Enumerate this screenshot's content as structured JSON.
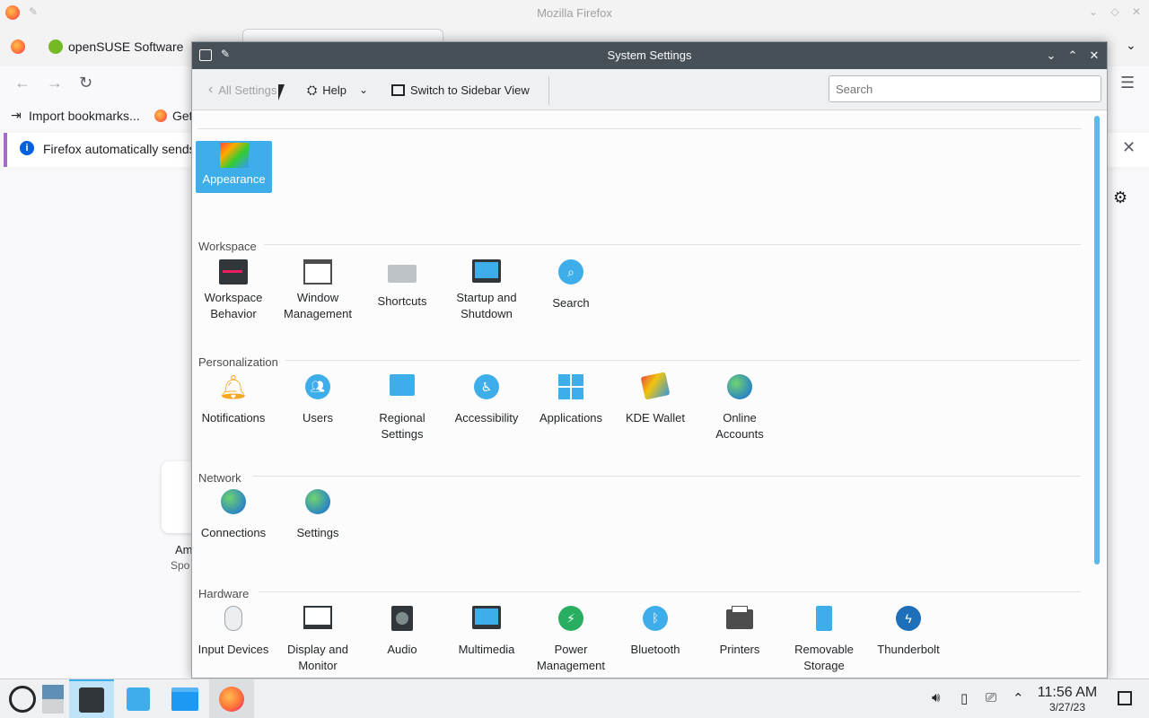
{
  "firefox": {
    "window_title": "Mozilla Firefox",
    "tab_title": "openSUSE Software",
    "bookmark_import": "Import bookmarks...",
    "bookmark_get": "Get",
    "notice_text": "Firefox automatically sends",
    "card_title": "Am",
    "card_sub": "Spo"
  },
  "settings": {
    "window_title": "System Settings",
    "toolbar": {
      "back_label": "All Settings",
      "help_label": "Help",
      "sidebar_view_label": "Switch to Sidebar View",
      "search_placeholder": "Search"
    },
    "top": {
      "appearance": "Appearance"
    },
    "workspace": {
      "title": "Workspace",
      "items": [
        "Workspace Behavior",
        "Window Management",
        "Shortcuts",
        "Startup and Shutdown",
        "Search"
      ]
    },
    "personalization": {
      "title": "Personalization",
      "items": [
        "Notifications",
        "Users",
        "Regional Settings",
        "Accessibility",
        "Applications",
        "KDE Wallet",
        "Online Accounts"
      ]
    },
    "network": {
      "title": "Network",
      "items": [
        "Connections",
        "Settings"
      ]
    },
    "hardware": {
      "title": "Hardware",
      "items": [
        "Input Devices",
        "Display and Monitor",
        "Audio",
        "Multimedia",
        "Power Management",
        "Bluetooth",
        "Printers",
        "Removable Storage",
        "Thunderbolt"
      ]
    }
  },
  "taskbar": {
    "time": "11:56 AM",
    "date": "3/27/23"
  },
  "colors": {
    "accent": "#3daee9",
    "titlebar": "#475057"
  }
}
